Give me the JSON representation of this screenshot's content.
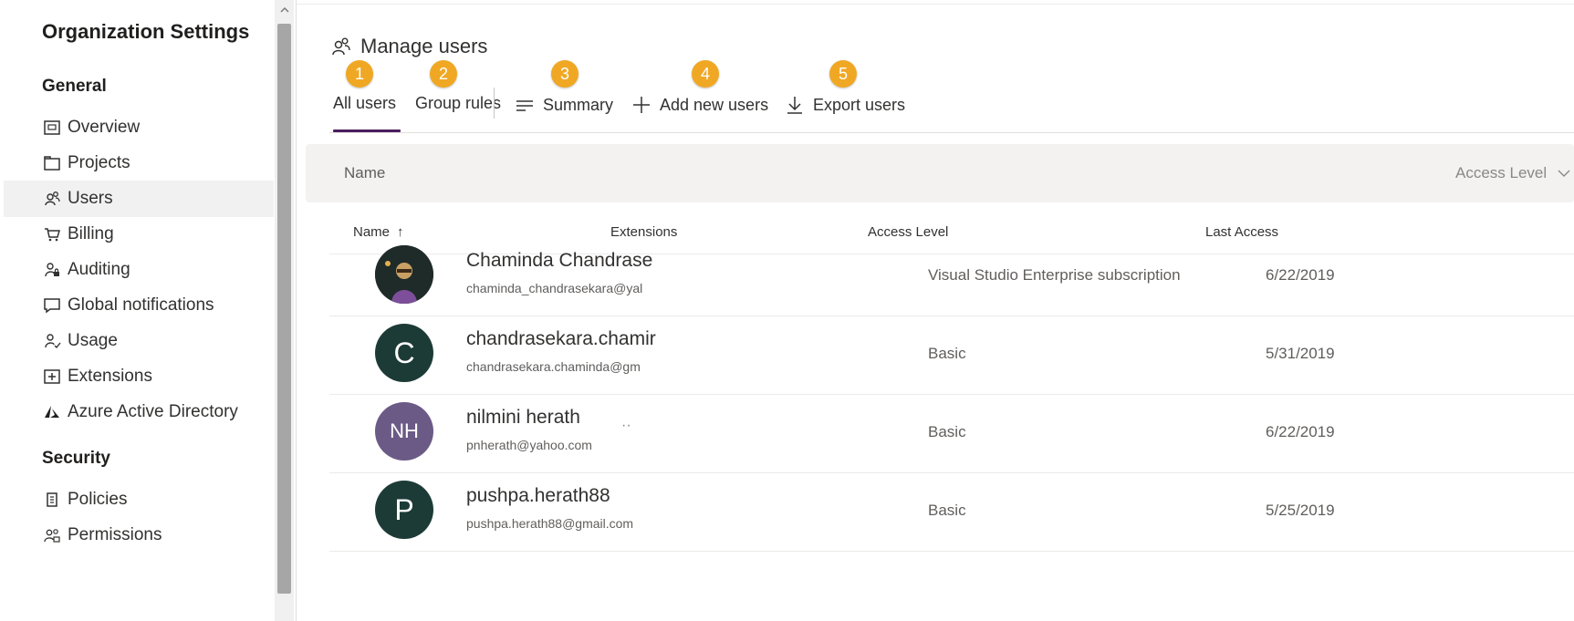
{
  "sidebar": {
    "title": "Organization Settings",
    "sections": [
      {
        "heading": "General",
        "items": [
          {
            "label": "Overview",
            "icon": "overview-icon"
          },
          {
            "label": "Projects",
            "icon": "projects-icon"
          },
          {
            "label": "Users",
            "icon": "users-icon",
            "selected": true
          },
          {
            "label": "Billing",
            "icon": "cart-icon"
          },
          {
            "label": "Auditing",
            "icon": "auditing-icon"
          },
          {
            "label": "Global notifications",
            "icon": "chat-icon"
          },
          {
            "label": "Usage",
            "icon": "usage-icon"
          },
          {
            "label": "Extensions",
            "icon": "extensions-icon"
          },
          {
            "label": "Azure Active Directory",
            "icon": "azure-icon"
          }
        ]
      },
      {
        "heading": "Security",
        "items": [
          {
            "label": "Policies",
            "icon": "policies-icon"
          },
          {
            "label": "Permissions",
            "icon": "permissions-icon"
          }
        ]
      }
    ]
  },
  "main": {
    "title": "Manage users",
    "tabs": [
      {
        "label": "All users",
        "active": true,
        "badge": "1"
      },
      {
        "label": "Group rules",
        "badge": "2"
      }
    ],
    "actions": [
      {
        "label": "Summary",
        "icon": "summary-icon",
        "badge": "3"
      },
      {
        "label": "Add new users",
        "icon": "plus-icon",
        "badge": "4"
      },
      {
        "label": "Export users",
        "icon": "download-icon",
        "badge": "5"
      }
    ],
    "filter": {
      "name_label": "Name",
      "access_label": "Access Level"
    },
    "columns": {
      "name": "Name",
      "name_sort": "↑",
      "extensions": "Extensions",
      "access": "Access Level",
      "last_access": "Last Access"
    },
    "users": [
      {
        "name": "Chaminda Chandrase",
        "email": "chaminda_chandrasekara@yal",
        "initials": "",
        "avatar_color": "#1f2d2b",
        "extensions": "",
        "access": "Visual Studio Enterprise subscription",
        "last_access": "6/22/2019"
      },
      {
        "name": "chandrasekara.chamir",
        "email": "chandrasekara.chaminda@gm",
        "initials": "C",
        "avatar_color": "#1d3b36",
        "extensions": "",
        "access": "Basic",
        "last_access": "5/31/2019"
      },
      {
        "name": "nilmini herath",
        "email": "pnherath@yahoo.com",
        "initials": "NH",
        "avatar_color": "#6b5a86",
        "extensions": "··",
        "access": "Basic",
        "last_access": "6/22/2019"
      },
      {
        "name": "pushpa.herath88",
        "email": "pushpa.herath88@gmail.com",
        "initials": "P",
        "avatar_color": "#1d3b36",
        "extensions": "",
        "access": "Basic",
        "last_access": "5/25/2019"
      }
    ]
  },
  "colors": {
    "badge": "#f0a824",
    "active_tab": "#4a1e5f",
    "selected_nav": "#f1f1f1"
  }
}
